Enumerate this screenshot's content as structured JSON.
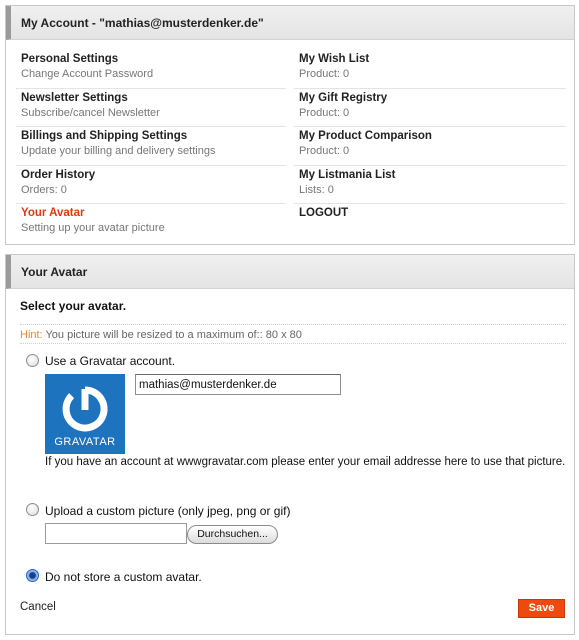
{
  "account": {
    "title": "My Account - \"mathias@musterdenker.de\"",
    "left_items": [
      {
        "title": "Personal Settings",
        "sub": "Change Account Password"
      },
      {
        "title": "Newsletter Settings",
        "sub": "Subscribe/cancel Newsletter"
      },
      {
        "title": "Billings and Shipping Settings",
        "sub": "Update your billing and delivery settings"
      },
      {
        "title": "Order History",
        "sub": "Orders: 0"
      },
      {
        "title": "Your Avatar",
        "sub": "Setting up your avatar picture"
      }
    ],
    "right_items": [
      {
        "title": "My Wish List",
        "sub": "Product: 0"
      },
      {
        "title": "My Gift Registry",
        "sub": "Product: 0"
      },
      {
        "title": "My Product Comparison",
        "sub": "Product: 0"
      },
      {
        "title": "My Listmania List",
        "sub": "Lists: 0"
      },
      {
        "title": "LOGOUT",
        "sub": ""
      }
    ]
  },
  "avatar": {
    "title": "Your Avatar",
    "heading": "Select your avatar.",
    "hint_label": "Hint:",
    "hint_text": "You picture will be resized to a maximum of:: 80 x 80",
    "option_gravatar": "Use a Gravatar account.",
    "gravatar_logo_text": "GRAVATAR",
    "gravatar_email_value": "mathias@musterdenker.de",
    "gravatar_description": "If you have an account at wwwgravatar.com please enter your email addresse here to use that picture.",
    "option_upload": "Upload a custom picture (only jpeg, png or gif)",
    "browse_label": "Durchsuchen...",
    "option_none": "Do not store a custom avatar.",
    "selected_option": "none",
    "cancel_label": "Cancel",
    "save_label": "Save"
  },
  "colors": {
    "accent": "#ee4a10",
    "active_link": "#e03a10",
    "hint_label": "#e8892b",
    "gravatar_blue": "#1e73be"
  }
}
